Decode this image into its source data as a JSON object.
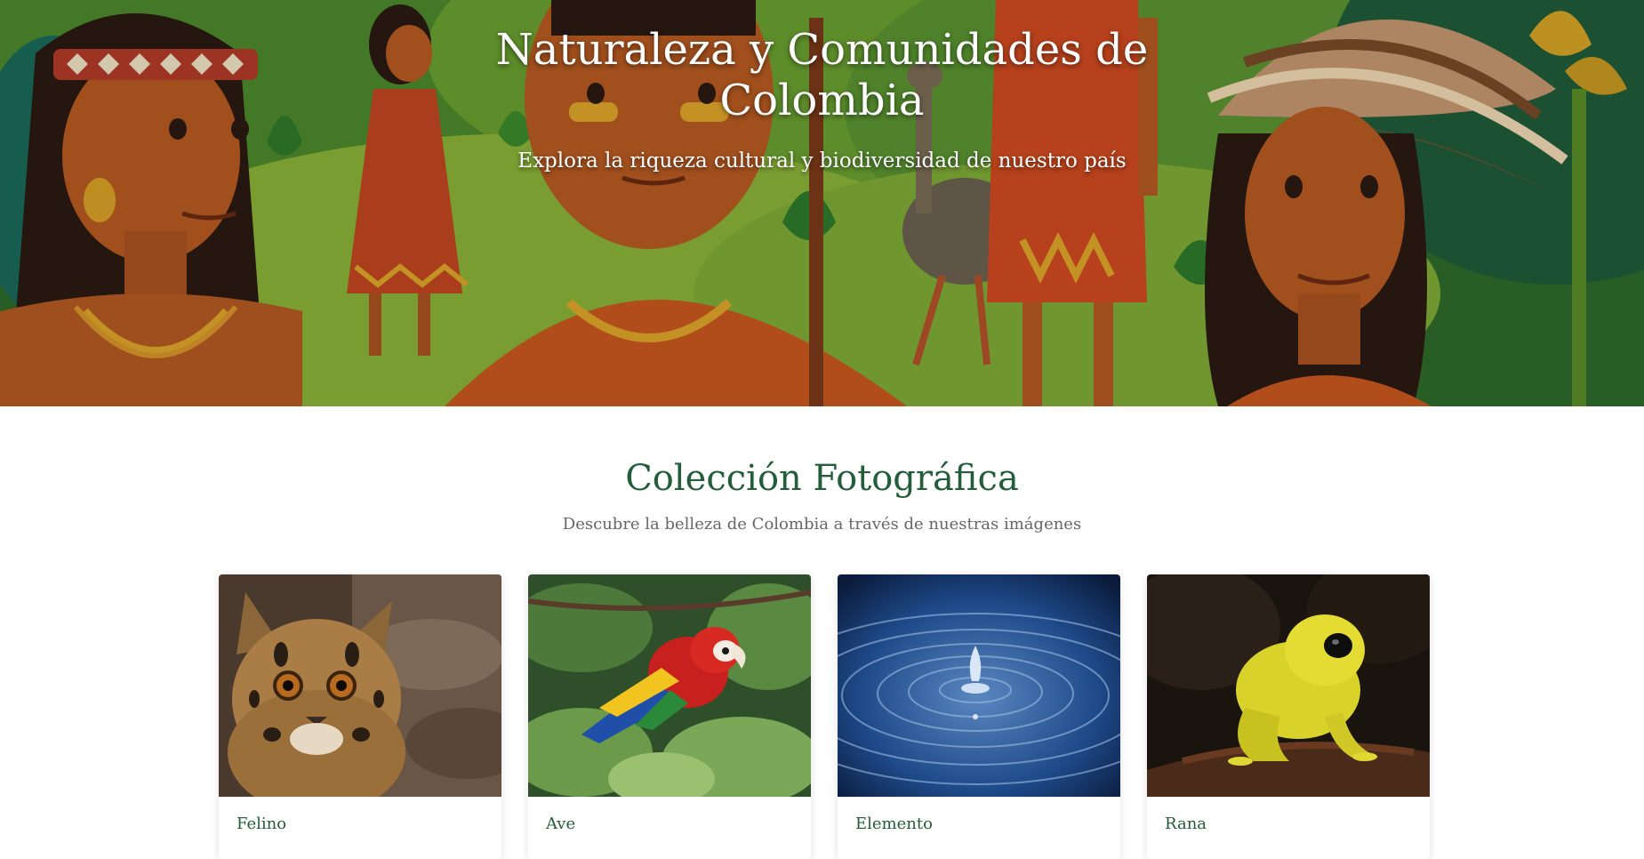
{
  "hero": {
    "title": "Naturaleza y Comunidades de Colombia",
    "subtitle": "Explora la riqueza cultural y biodiversidad de nuestro país"
  },
  "gallery": {
    "title": "Colección Fotográfica",
    "subtitle": "Descubre la belleza de Colombia a través de nuestras imágenes",
    "cards": [
      {
        "label": "Felino",
        "icon": "ocelot-photo"
      },
      {
        "label": "Ave",
        "icon": "macaw-photo"
      },
      {
        "label": "Elemento",
        "icon": "water-drop-photo"
      },
      {
        "label": "Rana",
        "icon": "yellow-frog-photo"
      }
    ]
  },
  "colors": {
    "accent_green": "#235d3a",
    "subtitle_gray": "#666666"
  }
}
